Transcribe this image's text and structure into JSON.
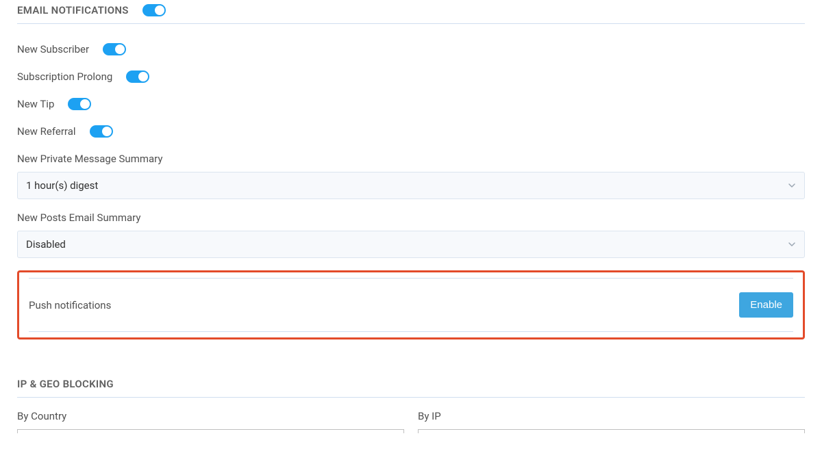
{
  "email_notifications": {
    "title": "EMAIL NOTIFICATIONS",
    "master_toggle": true,
    "rows": [
      {
        "label": "New Subscriber",
        "on": true
      },
      {
        "label": "Subscription Prolong",
        "on": true
      },
      {
        "label": "New Tip",
        "on": true
      },
      {
        "label": "New Referral",
        "on": true
      }
    ],
    "pm_summary_label": "New Private Message Summary",
    "pm_summary_value": "1 hour(s) digest",
    "posts_summary_label": "New Posts Email Summary",
    "posts_summary_value": "Disabled"
  },
  "push": {
    "label": "Push notifications",
    "button": "Enable"
  },
  "geo": {
    "title": "IP & GEO BLOCKING",
    "by_country_label": "By Country",
    "by_ip_label": "By IP"
  }
}
